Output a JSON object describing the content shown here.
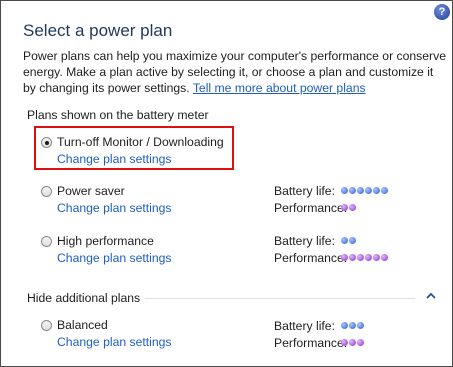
{
  "header": {
    "title": "Select a power plan",
    "help_icon": "help-icon",
    "help_glyph": "?",
    "intro_before_link": "Power plans can help you maximize your computer's performance or conserve energy. Make a plan active by selecting it, or choose a plan and customize it by changing its power settings. ",
    "intro_link": "Tell me more about power plans"
  },
  "battery_meter_section": {
    "label": "Plans shown on the battery meter"
  },
  "hidden_section": {
    "label": "Hide additional plans",
    "toggle_icon": "chevron-up-icon"
  },
  "labels": {
    "battery_life": "Battery life:",
    "performance": "Performance:",
    "change_settings": "Change plan settings"
  },
  "plans": [
    {
      "name": "Turn-off Monitor / Downloading",
      "selected": true,
      "highlighted": true
    },
    {
      "name": "Power saver",
      "selected": false,
      "battery_life": 6,
      "performance": 2
    },
    {
      "name": "High performance",
      "selected": false,
      "battery_life": 2,
      "performance": 6
    },
    {
      "name": "Balanced",
      "selected": false,
      "battery_life": 3,
      "performance": 3
    }
  ],
  "colors": {
    "battery_dot": "#3a68e0",
    "performance_dot": "#9a3fd0",
    "highlight_border": "#e01010",
    "link": "#1e5ebf"
  }
}
